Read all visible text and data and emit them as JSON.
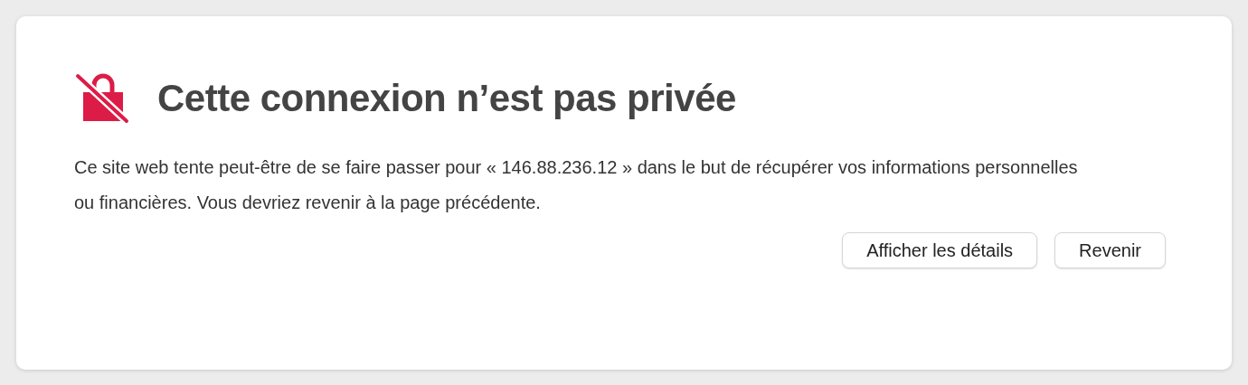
{
  "title": "Cette connexion n’est pas privée",
  "message": "Ce site web tente peut-être de se faire passer pour « 146.88.236.12 » dans le but de récupérer vos informations personnelles ou financières. Vous devriez revenir à la page précédente.",
  "buttons": [
    {
      "label": "Afficher les détails"
    },
    {
      "label": "Revenir"
    }
  ]
}
